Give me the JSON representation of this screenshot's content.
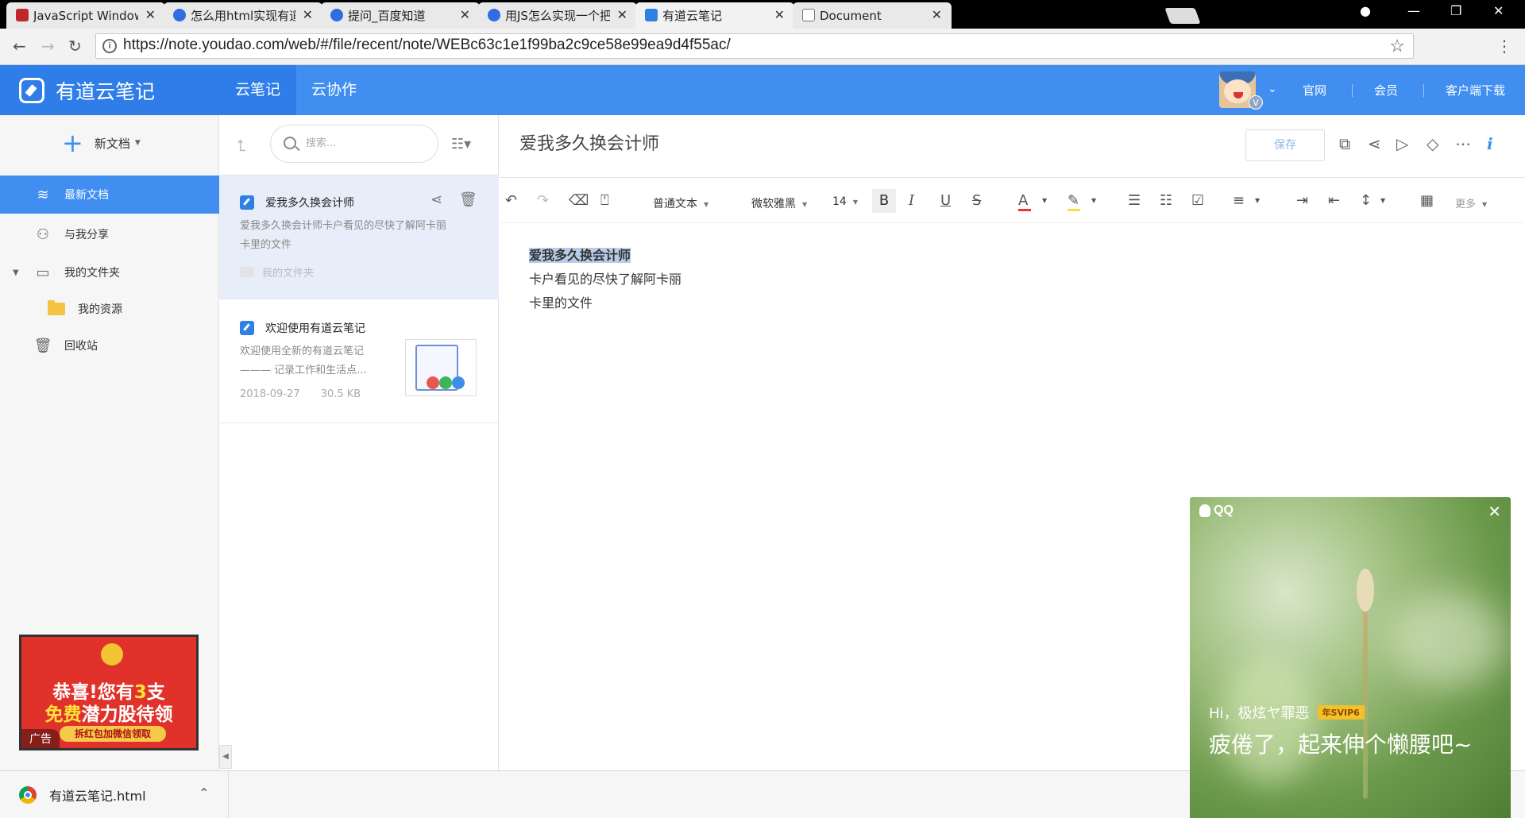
{
  "browser": {
    "tabs": [
      {
        "title": "JavaScript Window - 浏览器对象模型",
        "icon": "red-square-icon"
      },
      {
        "title": "怎么用html实现有道云笔记",
        "icon": "baidu-paw-icon"
      },
      {
        "title": "提问_百度知道",
        "icon": "baidu-paw-icon"
      },
      {
        "title": "用JS怎么实现一个把一个",
        "icon": "baidu-paw-icon"
      },
      {
        "title": "有道云笔记",
        "icon": "youdao-note-icon"
      },
      {
        "title": "Document",
        "icon": "document-icon"
      }
    ],
    "url": "https://note.youdao.com/web/#/file/recent/note/WEBc63c1e1f99ba2c9ce58e99ea9d4f55ac/"
  },
  "app": {
    "brand": "有道云笔记",
    "nav_tabs": [
      "云笔记",
      "云协作"
    ],
    "top_links": [
      "官网",
      "会员",
      "客户端下载"
    ],
    "avatar_badge": "V"
  },
  "sidebar": {
    "new_doc": "新文档",
    "items": [
      {
        "label": "最新文档",
        "icon": "layers-icon"
      },
      {
        "label": "与我分享",
        "icon": "user-share-icon"
      },
      {
        "label": "我的文件夹",
        "icon": "folder-icon"
      },
      {
        "label": "我的资源",
        "icon": "yellow-folder-icon"
      },
      {
        "label": "回收站",
        "icon": "trash-icon"
      }
    ],
    "ad": {
      "line1_a": "恭喜!您有",
      "line1_b": "3",
      "line1_c": "支",
      "line2_a": "免费",
      "line2_b": "潜力股待领",
      "cta": "拆红包加微信领取",
      "label": "广告"
    }
  },
  "notelist": {
    "search_placeholder": "搜索...",
    "notes": [
      {
        "title": "爱我多久换会计师",
        "snippet1": "爱我多久换会计师卡户看见的尽快了解阿卡丽",
        "snippet2": "卡里的文件",
        "folder": "我的文件夹"
      },
      {
        "title": "欢迎使用有道云笔记",
        "snippet1": "欢迎使用全新的有道云笔记",
        "snippet2": "——— 记录工作和生活点...",
        "date": "2018-09-27",
        "size": "30.5 KB"
      }
    ]
  },
  "editor": {
    "title": "爱我多久换会计师",
    "save_label": "保存",
    "format": {
      "paragraph": "普通文本",
      "font": "微软雅黑",
      "size": "14",
      "more": "更多"
    },
    "lines": [
      "爱我多久换会计师",
      "卡户看见的尽快了解阿卡丽",
      "卡里的文件"
    ]
  },
  "download": {
    "file": "有道云笔记.html"
  },
  "qq": {
    "logo": "QQ",
    "greeting": "Hi，极炫ヤ罪恶",
    "vip": "年SVIP6",
    "message": "疲倦了，起来伸个懒腰吧~"
  }
}
